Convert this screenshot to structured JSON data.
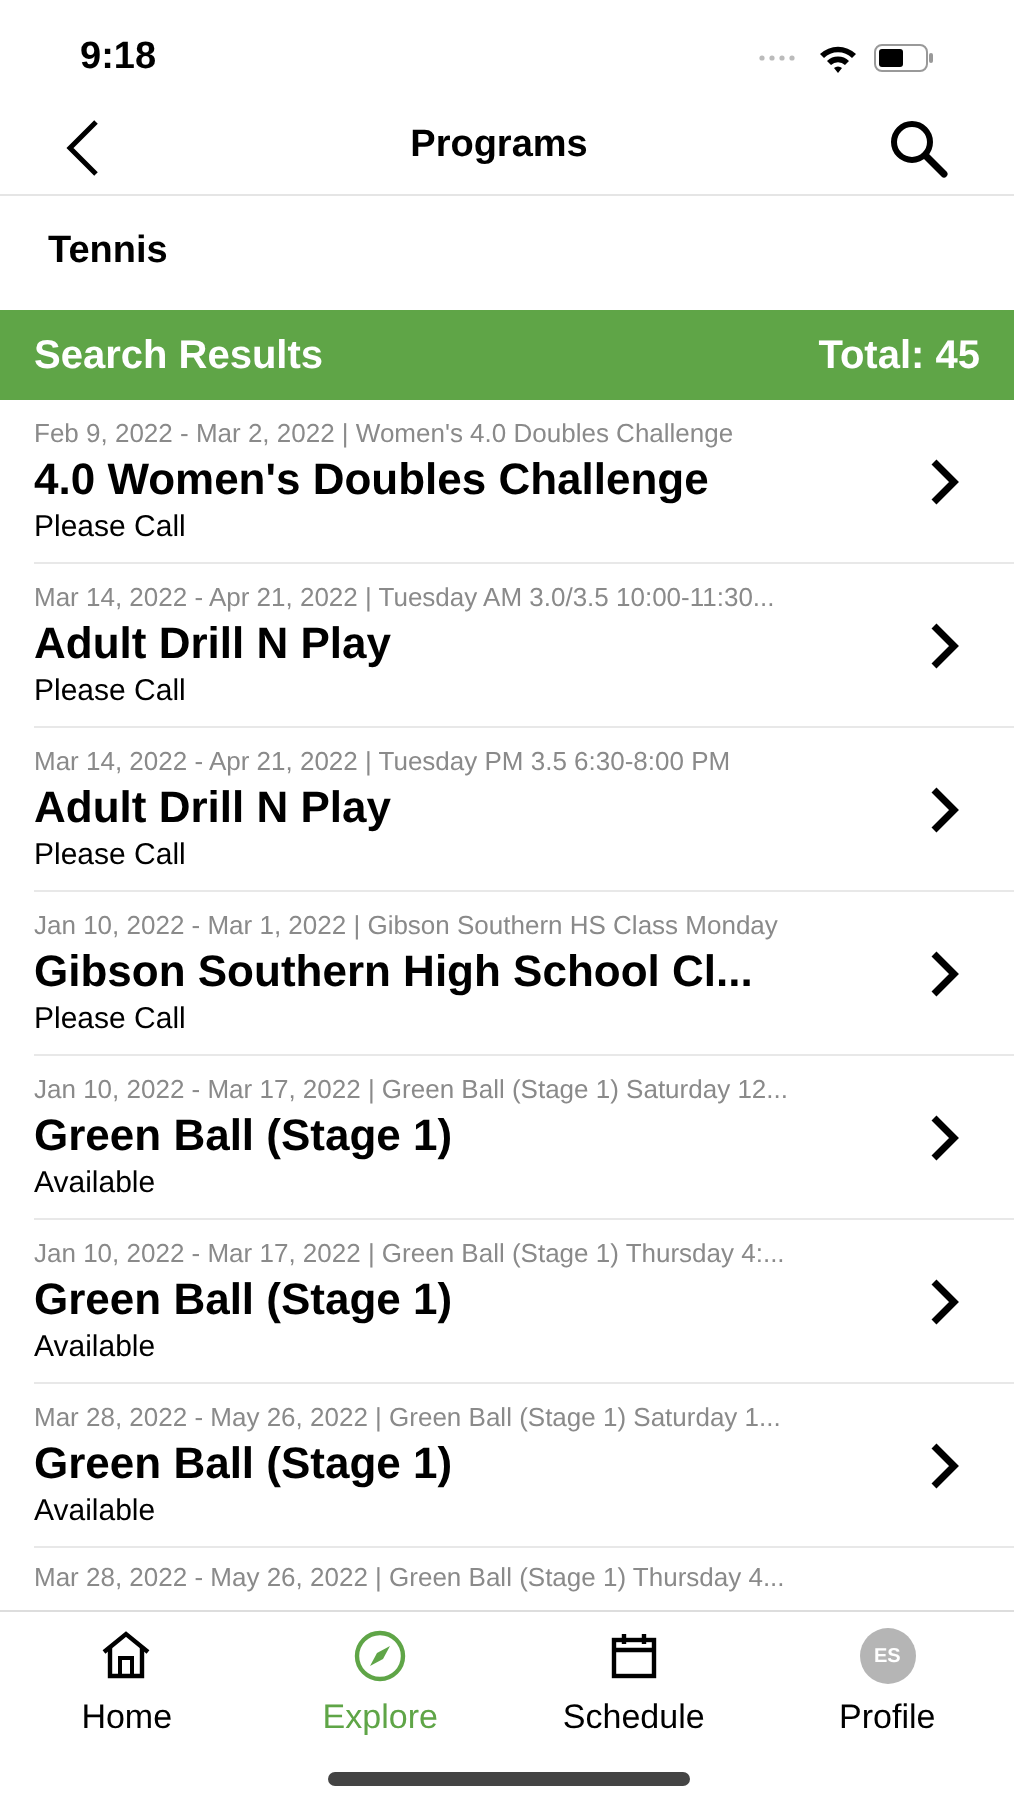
{
  "status_bar": {
    "time": "9:18"
  },
  "nav": {
    "title": "Programs"
  },
  "category": "Tennis",
  "results_header": {
    "title": "Search Results",
    "total": "Total: 45"
  },
  "results": [
    {
      "meta": "Feb 9, 2022 - Mar 2, 2022 | Women's 4.0 Doubles Challenge",
      "title": "4.0 Women's Doubles Challenge",
      "availability": "Please Call"
    },
    {
      "meta": "Mar 14, 2022 - Apr 21, 2022 | Tuesday AM 3.0/3.5 10:00-11:30...",
      "title": "Adult Drill N Play",
      "availability": "Please Call"
    },
    {
      "meta": "Mar 14, 2022 - Apr 21, 2022 | Tuesday PM 3.5 6:30-8:00 PM",
      "title": "Adult Drill N Play",
      "availability": "Please Call"
    },
    {
      "meta": "Jan 10, 2022 - Mar 1, 2022 | Gibson Southern HS Class Monday",
      "title": "Gibson Southern High School Cl...",
      "availability": "Please Call"
    },
    {
      "meta": "Jan 10, 2022 - Mar 17, 2022 | Green Ball (Stage 1) Saturday 12...",
      "title": "Green Ball (Stage 1)",
      "availability": "Available"
    },
    {
      "meta": "Jan 10, 2022 - Mar 17, 2022 | Green Ball (Stage 1) Thursday 4:...",
      "title": "Green Ball (Stage 1)",
      "availability": "Available"
    },
    {
      "meta": "Mar 28, 2022 - May 26, 2022 | Green Ball (Stage 1) Saturday 1...",
      "title": "Green Ball (Stage 1)",
      "availability": "Available"
    },
    {
      "meta": "Mar 28, 2022 - May 26, 2022 | Green Ball (Stage 1) Thursday 4..."
    }
  ],
  "tab_bar": [
    {
      "kind": "home",
      "label": "Home",
      "selected": false
    },
    {
      "kind": "explore",
      "label": "Explore",
      "selected": true
    },
    {
      "kind": "schedule",
      "label": "Schedule",
      "selected": false
    },
    {
      "kind": "profile",
      "label": "Profile",
      "selected": false,
      "initials": "ES"
    }
  ]
}
